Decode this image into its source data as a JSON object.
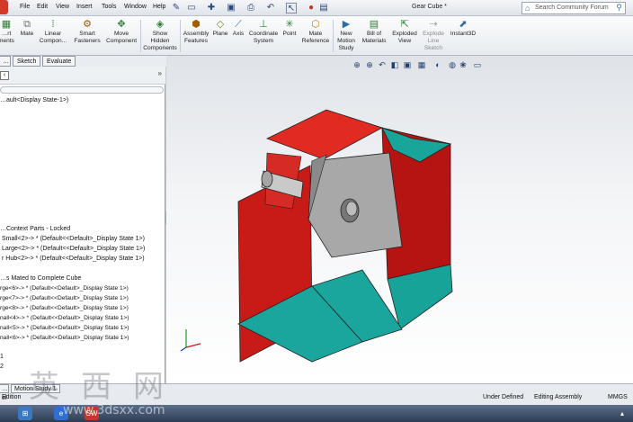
{
  "menubar": {
    "items": [
      "File",
      "Edit",
      "View",
      "Insert",
      "Tools",
      "Window",
      "Help"
    ],
    "document_title": "Gear Cube *",
    "search_placeholder": "Search Community Forum"
  },
  "toolbar": {
    "items": [
      {
        "label": "…rt\nments",
        "icon": "insert-components-icon"
      },
      {
        "label": "Mate",
        "icon": "mate-icon"
      },
      {
        "label": "Linear\nCompon...",
        "icon": "linear-pattern-icon"
      },
      {
        "label": "Smart\nFasteners",
        "icon": "smart-fasteners-icon"
      },
      {
        "label": "Move\nComponent",
        "icon": "move-component-icon"
      },
      {
        "label": "Show\nHidden\nComponents",
        "icon": "show-hidden-icon"
      },
      {
        "label": "Assembly\nFeatures",
        "icon": "assembly-features-icon"
      },
      {
        "label": "Plane",
        "icon": "plane-icon"
      },
      {
        "label": "Axis",
        "icon": "axis-icon"
      },
      {
        "label": "Coordinate\nSystem",
        "icon": "coordinate-system-icon"
      },
      {
        "label": "Point",
        "icon": "point-icon"
      },
      {
        "label": "Mate\nReference",
        "icon": "mate-reference-icon"
      },
      {
        "label": "New\nMotion\nStudy",
        "icon": "motion-study-icon"
      },
      {
        "label": "Bill of\nMaterials",
        "icon": "bom-icon"
      },
      {
        "label": "Exploded\nView",
        "icon": "exploded-view-icon"
      },
      {
        "label": "Explode\nLine\nSketch",
        "icon": "explode-line-icon"
      },
      {
        "label": "Instant3D",
        "icon": "instant3d-icon"
      }
    ]
  },
  "tabs": [
    "…ut",
    "Sketch",
    "Evaluate"
  ],
  "tree": {
    "config": "…ault<Display State-1>)",
    "header1": "…Context Parts - Locked",
    "locked": [
      "Small<2>-> * (Default<<Default>_Display State 1>)",
      "Large<2>-> * (Default<<Default>_Display State 1>)",
      "r Hub<2>-> * (Default<<Default>_Display State 1>)"
    ],
    "header2": "…s Mated to Complete Cube",
    "mated": [
      "rge<6>-> * (Default<<Default>_Display State 1>)",
      "rge<7>-> * (Default<<Default>_Display State 1>)",
      "rge<8>-> * (Default<<Default>_Display State 1>)",
      "nall<4>-> * (Default<<Default>_Display State 1>)",
      "nall<5>-> * (Default<<Default>_Display State 1>)",
      "nall<6>-> * (Default<<Default>_Display State 1>)"
    ],
    "tail": [
      "1",
      "2"
    ]
  },
  "bottom": {
    "tabs": [
      "…el",
      "Motion Study 1"
    ],
    "left_status": "Edition",
    "status": [
      "Under Defined",
      "Editing Assembly",
      "MMGS"
    ]
  },
  "watermark": {
    "chars": [
      "英",
      "西",
      "网"
    ],
    "url": "www.3dsxx.com"
  },
  "colors": {
    "red": "#d8201c",
    "teal": "#1aa69c",
    "gray": "#9a9a9a"
  }
}
